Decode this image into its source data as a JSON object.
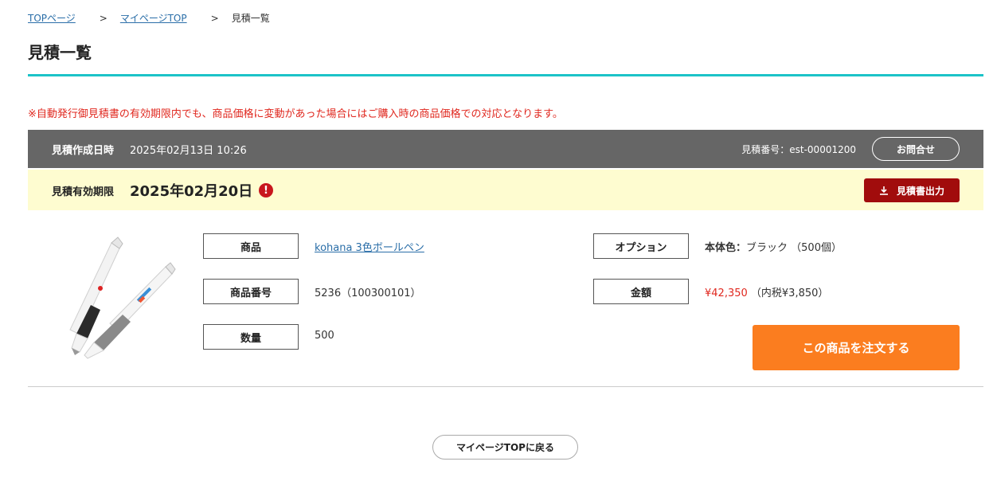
{
  "breadcrumb": {
    "items": [
      "TOPページ",
      "マイページTOP"
    ],
    "separator": ">",
    "current": "見積一覧"
  },
  "page": {
    "title": "見積一覧",
    "notice": "※自動発行御見積書の有効期限内でも、商品価格に変動があった場合にはご購入時の商品価格での対応となります。"
  },
  "quote": {
    "created_label": "見積作成日時",
    "created_value": "2025年02月13日 10:26",
    "number_text": "見積番号：est-00001200",
    "inquiry_label": "お問合せ",
    "expiry_label": "見積有効期限",
    "expiry_date": "2025年02月20日",
    "warning_glyph": "!",
    "export_label": "見積書出力"
  },
  "product": {
    "name_label": "商品",
    "name_value": "kohana 3色ボールペン",
    "code_label": "商品番号",
    "code_value": "5236（100300101）",
    "qty_label": "数量",
    "qty_value": "500",
    "option_label": "オプション",
    "option_key": "本体色：",
    "option_value": "ブラック （500個）",
    "amount_label": "金額",
    "amount_value": "¥42,350",
    "amount_tax": "（内税¥3,850）",
    "order_label": "この商品を注文する"
  },
  "footer": {
    "back_label": "マイページTOPに戻る"
  },
  "colors": {
    "accent_teal": "#1cc3c8",
    "notice_red": "#e0281f",
    "header_gray": "#666666",
    "expiry_bg": "#fefcd0",
    "export_dark_red": "#a10c0c",
    "order_orange": "#fb7d1f"
  }
}
